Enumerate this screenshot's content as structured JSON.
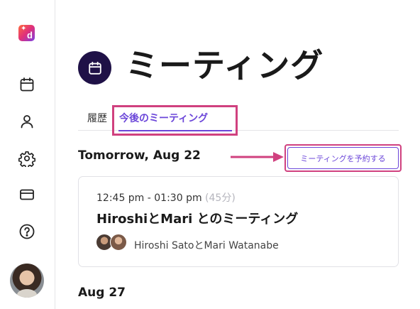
{
  "app": {
    "logo_letter": "d",
    "logo_spark": "✦",
    "brand_colors": {
      "accent": "#6b46d9",
      "highlight": "#d0417f",
      "header_icon_bg": "#1f1147"
    }
  },
  "sidebar": {
    "items": [
      {
        "name": "calendar",
        "icon": "calendar-icon"
      },
      {
        "name": "user",
        "icon": "user-icon"
      },
      {
        "name": "settings",
        "icon": "gear-icon"
      },
      {
        "name": "billing",
        "icon": "credit-card-icon"
      },
      {
        "name": "help",
        "icon": "help-icon"
      }
    ]
  },
  "page": {
    "title": "ミーティング"
  },
  "tabs": [
    {
      "label": "履歴",
      "active": false
    },
    {
      "label": "今後のミーティング",
      "active": true
    }
  ],
  "schedule_button": {
    "label": "ミーティングを予約する"
  },
  "days": [
    {
      "heading": "Tomorrow, Aug 22",
      "meetings": [
        {
          "time": "12:45 pm - 01:30 pm",
          "duration": "(45分)",
          "title": "HiroshiとMari とのミーティング",
          "participants": "Hiroshi SatoとMari Watanabe"
        }
      ]
    },
    {
      "heading": "Aug 27",
      "meetings": []
    }
  ]
}
